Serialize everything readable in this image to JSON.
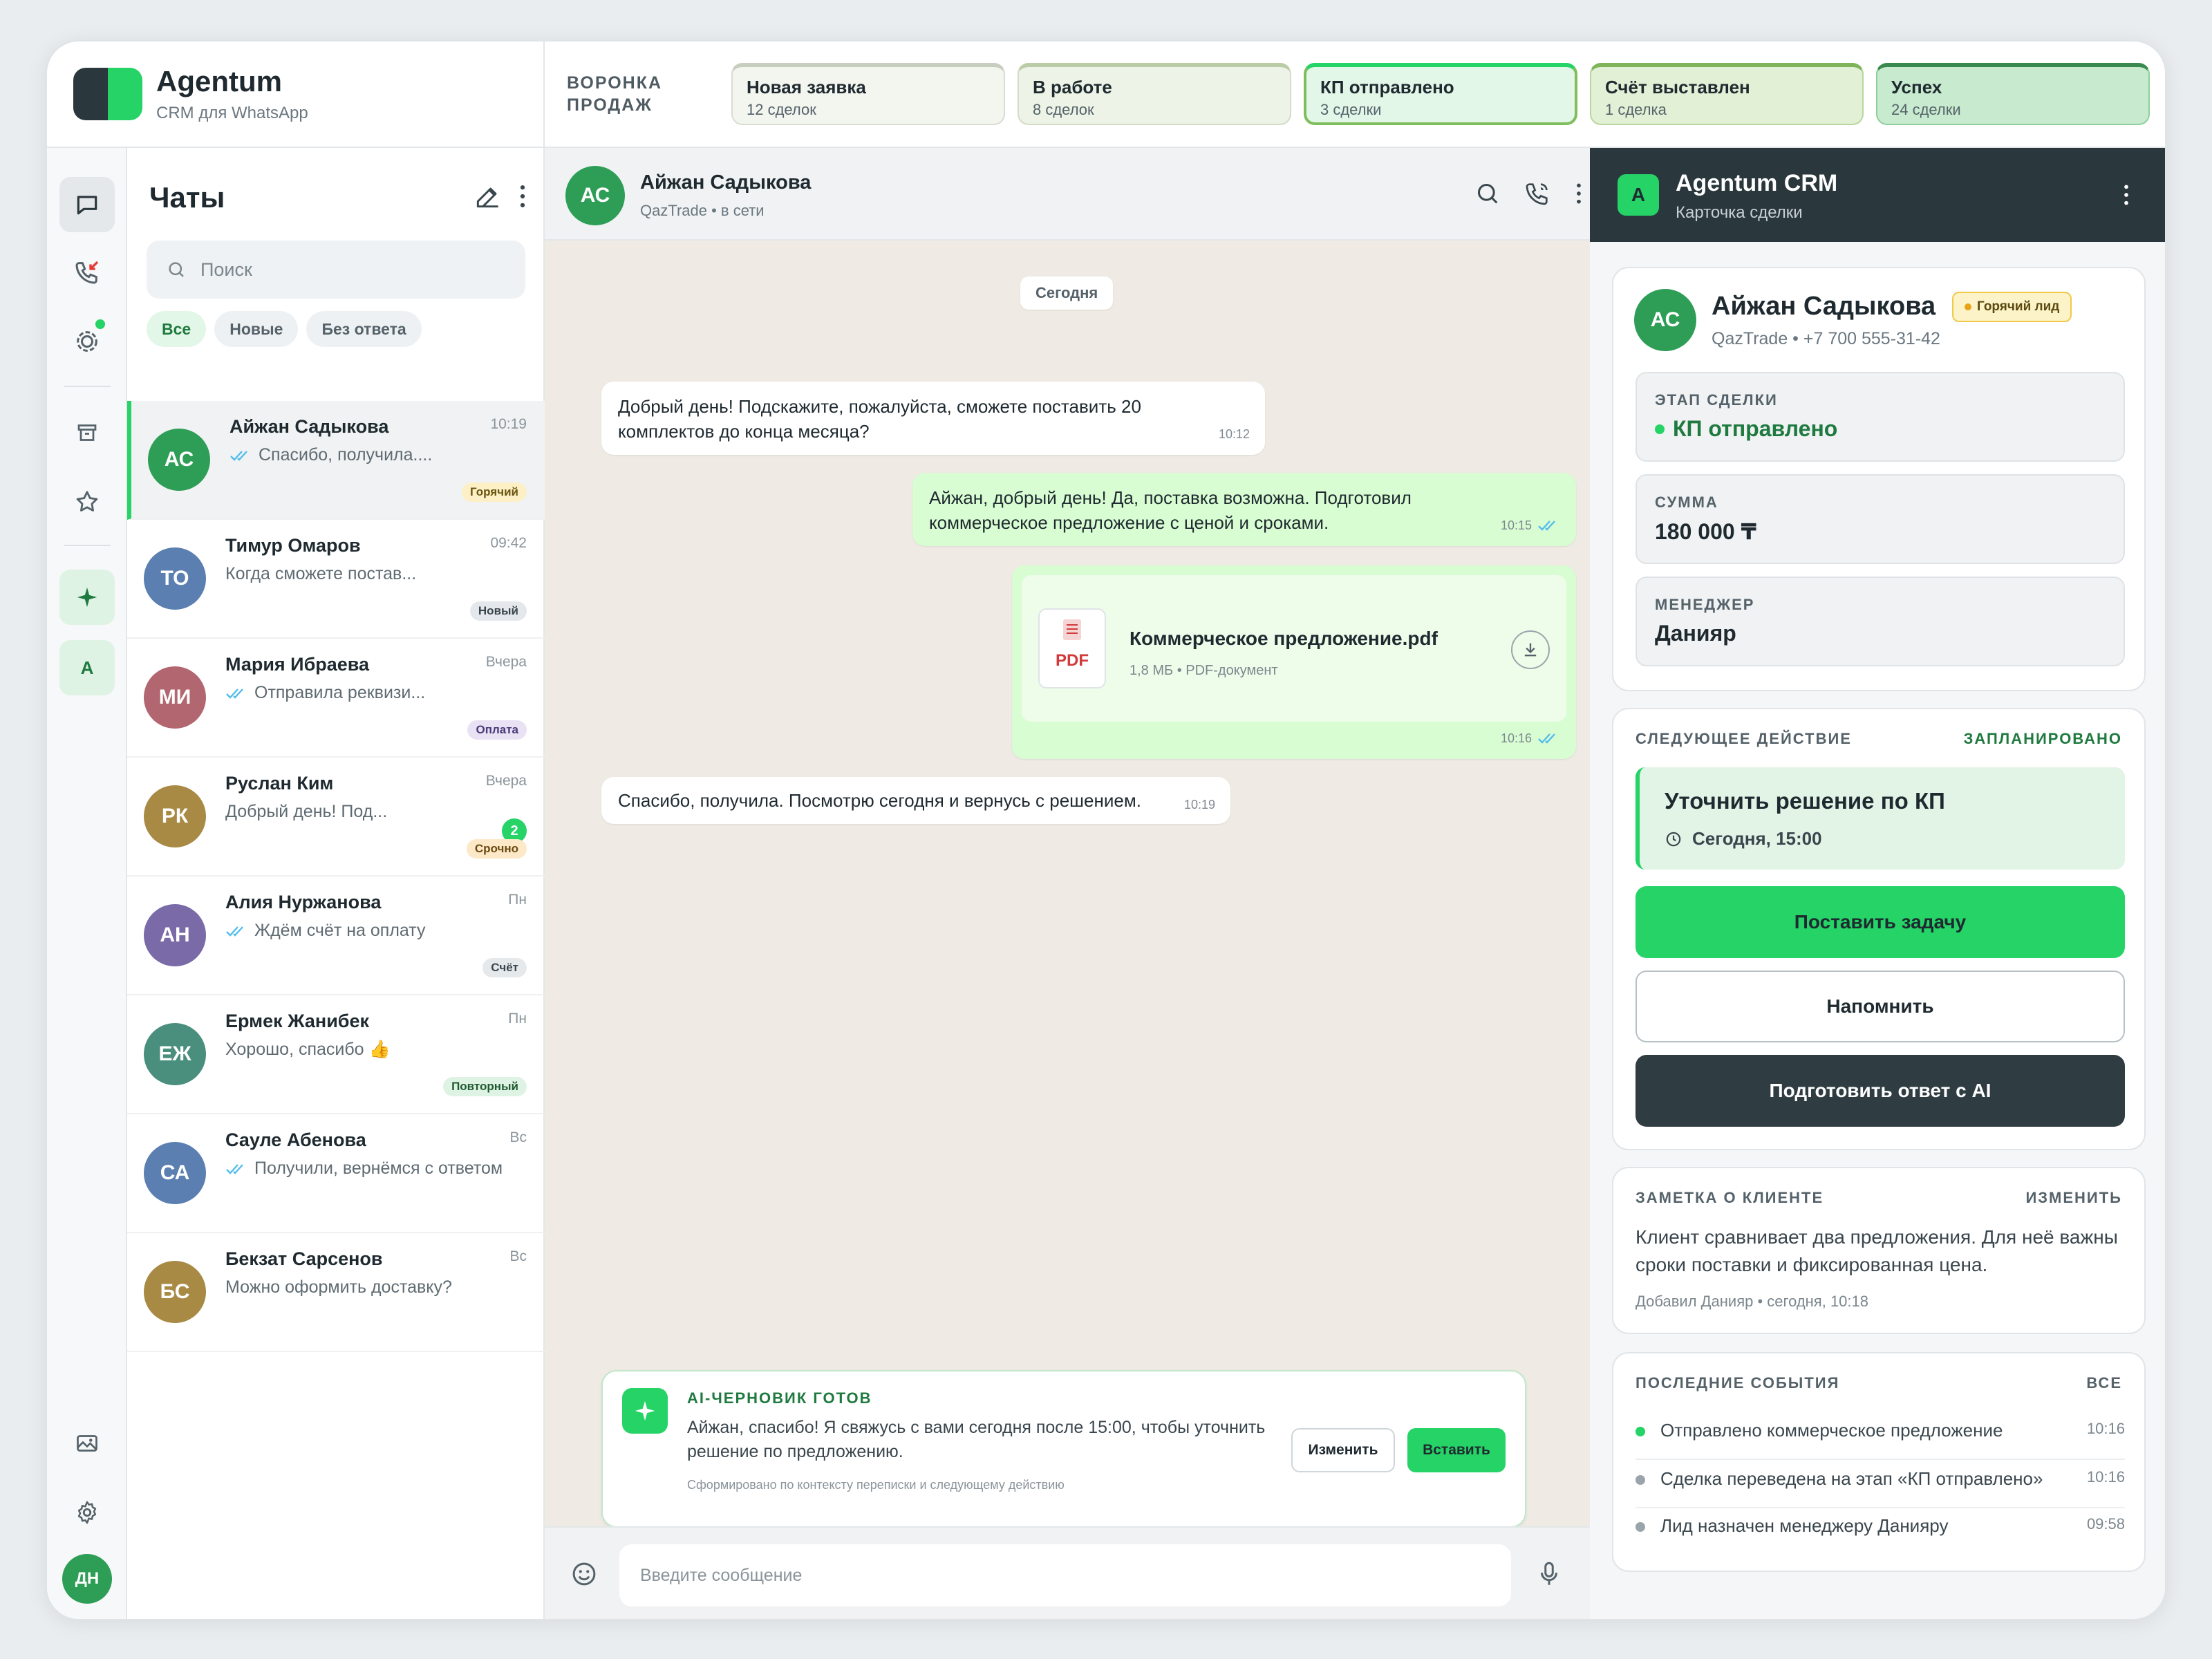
{
  "brand": {
    "name": "Agentum",
    "subtitle": "CRM для WhatsApp"
  },
  "funnel": {
    "label": "ВОРОНКА ПРОДАЖ",
    "stages": [
      {
        "name": "Новая заявка",
        "count": "12 сделок"
      },
      {
        "name": "В работе",
        "count": "8 сделок"
      },
      {
        "name": "КП отправлено",
        "count": "3 сделки"
      },
      {
        "name": "Счёт выставлен",
        "count": "1 сделка"
      },
      {
        "name": "Успех",
        "count": "24 сделки"
      }
    ]
  },
  "rail": {
    "workspace_initial": "A",
    "user_initials": "ДН"
  },
  "chatlist": {
    "title": "Чаты",
    "search_placeholder": "Поиск",
    "filters": [
      "Все",
      "Новые",
      "Без ответа"
    ],
    "chats": [
      {
        "initials": "АС",
        "name": "Айжан Садыкова",
        "time": "10:19",
        "preview": "Спасибо, получила....",
        "tag": "Горячий",
        "read": true,
        "color": "#2e9e57"
      },
      {
        "initials": "ТО",
        "name": "Тимур Омаров",
        "time": "09:42",
        "preview": "Когда сможете постав...",
        "tag": "Новый",
        "read": false,
        "color": "#5a7fb0"
      },
      {
        "initials": "МИ",
        "name": "Мария Ибраева",
        "time": "Вчера",
        "preview": "Отправила реквизи...",
        "tag": "Оплата",
        "read": true,
        "color": "#b26670"
      },
      {
        "initials": "РК",
        "name": "Руслан Ким",
        "time": "Вчера",
        "preview": "Добрый день! Под...",
        "tag": "Срочно",
        "unread": "2",
        "read": false,
        "color": "#a88a45"
      },
      {
        "initials": "АН",
        "name": "Алия Нуржанова",
        "time": "Пн",
        "preview": "Ждём счёт на оплату",
        "tag": "Счёт",
        "read": true,
        "color": "#7a6aa8"
      },
      {
        "initials": "ЕЖ",
        "name": "Ермек Жанибек",
        "time": "Пн",
        "preview": "Хорошо, спасибо 👍",
        "tag": "Повторный",
        "read": false,
        "color": "#4a8f7e"
      },
      {
        "initials": "СА",
        "name": "Сауле Абенова",
        "time": "Вс",
        "preview": "Получили, вернёмся с ответом",
        "read": true,
        "color": "#5a7fb0"
      },
      {
        "initials": "БС",
        "name": "Бекзат Сарсенов",
        "time": "Вс",
        "preview": "Можно оформить доставку?",
        "read": false,
        "color": "#a88a45"
      }
    ]
  },
  "conversation": {
    "contact_initials": "АС",
    "contact_name": "Айжан Садыкова",
    "contact_status": "QazTrade • в сети",
    "date_label": "Сегодня",
    "messages": [
      {
        "text": "Добрый день! Подскажите, пожалуйста, сможете поставить 20 комплектов до конца месяца?",
        "time": "10:12"
      },
      {
        "text": "Айжан, добрый день! Да, поставка возможна. Подготовил коммерческое предложение с ценой и сроками.",
        "time": "10:15"
      },
      {
        "file_name": "Коммерческое предложение.pdf",
        "file_meta": "1,8 МБ • PDF-документ",
        "file_type": "PDF",
        "time": "10:16"
      },
      {
        "text": "Спасибо, получила. Посмотрю сегодня и вернусь с решением.",
        "time": "10:19"
      }
    ],
    "ai_draft": {
      "title": "AI-ЧЕРНОВИК ГОТОВ",
      "text": "Айжан, спасибо! Я свяжусь с вами сегодня после 15:00, чтобы уточнить решение по предложению.",
      "source": "Сформировано по контексту переписки и следующему действию",
      "edit_label": "Изменить",
      "insert_label": "Вставить"
    },
    "composer_placeholder": "Введите сообщение"
  },
  "panel": {
    "header_initial": "A",
    "title": "Agentum CRM",
    "subtitle": "Карточка сделки",
    "client": {
      "initials": "АС",
      "name": "Айжан Садыкова",
      "badge": "Горячий лид",
      "meta": "QazTrade • +7 700 555-31-42"
    },
    "stage": {
      "label": "ЭТАП СДЕЛКИ",
      "value": "КП отправлено"
    },
    "amount": {
      "label": "СУММА",
      "value": "180 000 ₸"
    },
    "manager": {
      "label": "МЕНЕДЖЕР",
      "value": "Данияр"
    },
    "next_action": {
      "title": "СЛЕДУЮЩЕЕ ДЕЙСТВИЕ",
      "status": "ЗАПЛАНИРОВАНО",
      "task": "Уточнить решение по КП",
      "when": "Сегодня, 15:00",
      "btn_task": "Поставить задачу",
      "btn_remind": "Напомнить",
      "btn_ai": "Подготовить ответ с AI"
    },
    "note": {
      "title": "ЗАМЕТКА О КЛИЕНТЕ",
      "edit": "ИЗМЕНИТЬ",
      "text": "Клиент сравнивает два предложения. Для неё важны сроки поставки и фиксированная цена.",
      "author": "Добавил Данияр • сегодня, 10:18"
    },
    "events": {
      "title": "ПОСЛЕДНИЕ СОБЫТИЯ",
      "all": "ВСЕ",
      "items": [
        {
          "text": "Отправлено коммерческое предложение",
          "time": "10:16",
          "color": "#25d366"
        },
        {
          "text": "Сделка переведена на этап «КП отправлено»",
          "time": "10:16",
          "color": "#9aa5ab"
        },
        {
          "text": "Лид назначен менеджеру Данияру",
          "time": "09:58",
          "color": "#9aa5ab"
        }
      ]
    }
  },
  "colors": {
    "accent": "#25d366",
    "dark": "#2a373d",
    "outgoing_bubble": "#d9fdd3",
    "chat_bg": "#efebe4"
  }
}
